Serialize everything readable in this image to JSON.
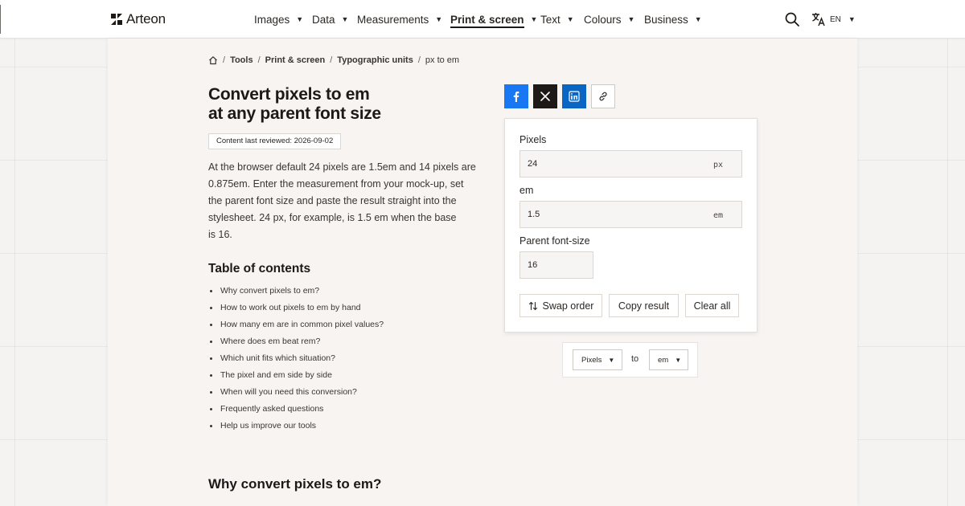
{
  "header": {
    "brand": "Arteon",
    "nav": [
      {
        "label": "Images",
        "active": false
      },
      {
        "label": "Data",
        "active": false
      },
      {
        "label": "Measurements",
        "active": false
      },
      {
        "label": "Print & screen",
        "active": true
      },
      {
        "label": "Text",
        "active": false
      },
      {
        "label": "Colours",
        "active": false
      },
      {
        "label": "Business",
        "active": false
      }
    ],
    "language": "EN"
  },
  "breadcrumb": {
    "items": [
      "Tools",
      "Print & screen",
      "Typographic units",
      "px to em"
    ],
    "separator": "/"
  },
  "page": {
    "title_line1": "Convert pixels to em",
    "title_line2": "at any parent font size",
    "reviewed": "Content last reviewed: 2026-09-02",
    "intro": "At the browser default 24 pixels are 1.5em and 14 pixels are 0.875em. Enter the measurement from your mock-up, set the parent font size and paste the result straight into the stylesheet. 24 px, for example, is 1.5 em when the base is 16.",
    "intro_lines": [
      "At the browser default 24 pixels are 1.5em and 14 pixels are",
      "0.875em. Enter the measurement from your mock-up, set",
      "the parent font size and paste the result straight into the",
      "stylesheet. 24 px, for example, is 1.5 em when the base",
      "is 16."
    ]
  },
  "toc": {
    "title": "Table of contents",
    "items": [
      "Why convert pixels to em?",
      "How to work out pixels to em by hand",
      "How many em are in common pixel values?",
      "Where does em beat rem?",
      "Which unit fits which situation?",
      "The pixel and em side by side",
      "When will you need this conversion?",
      "Frequently asked questions",
      "Help us improve our tools"
    ]
  },
  "section": {
    "title": "Why convert pixels to em?"
  },
  "share": {
    "icons": [
      "facebook-icon",
      "x-icon",
      "linkedin-icon",
      "link-icon"
    ],
    "colors": {
      "facebook": "#1877f2",
      "x": "#1c1917",
      "linkedin": "#0a66c2"
    }
  },
  "converter": {
    "pixels_label": "Pixels",
    "pixels_value": "24",
    "pixels_unit": "px",
    "em_label": "em",
    "em_value": "1.5",
    "em_unit": "em",
    "parent_label": "Parent font-size",
    "parent_value": "16",
    "swap_label": "Swap order",
    "copy_label": "Copy result",
    "clear_label": "Clear all"
  },
  "unit_selector": {
    "from": "Pixels",
    "to_word": "to",
    "to": "em"
  },
  "colors": {
    "background": "#f5f3f1",
    "panel": "#f7f4f2",
    "text": "#2b2724"
  }
}
